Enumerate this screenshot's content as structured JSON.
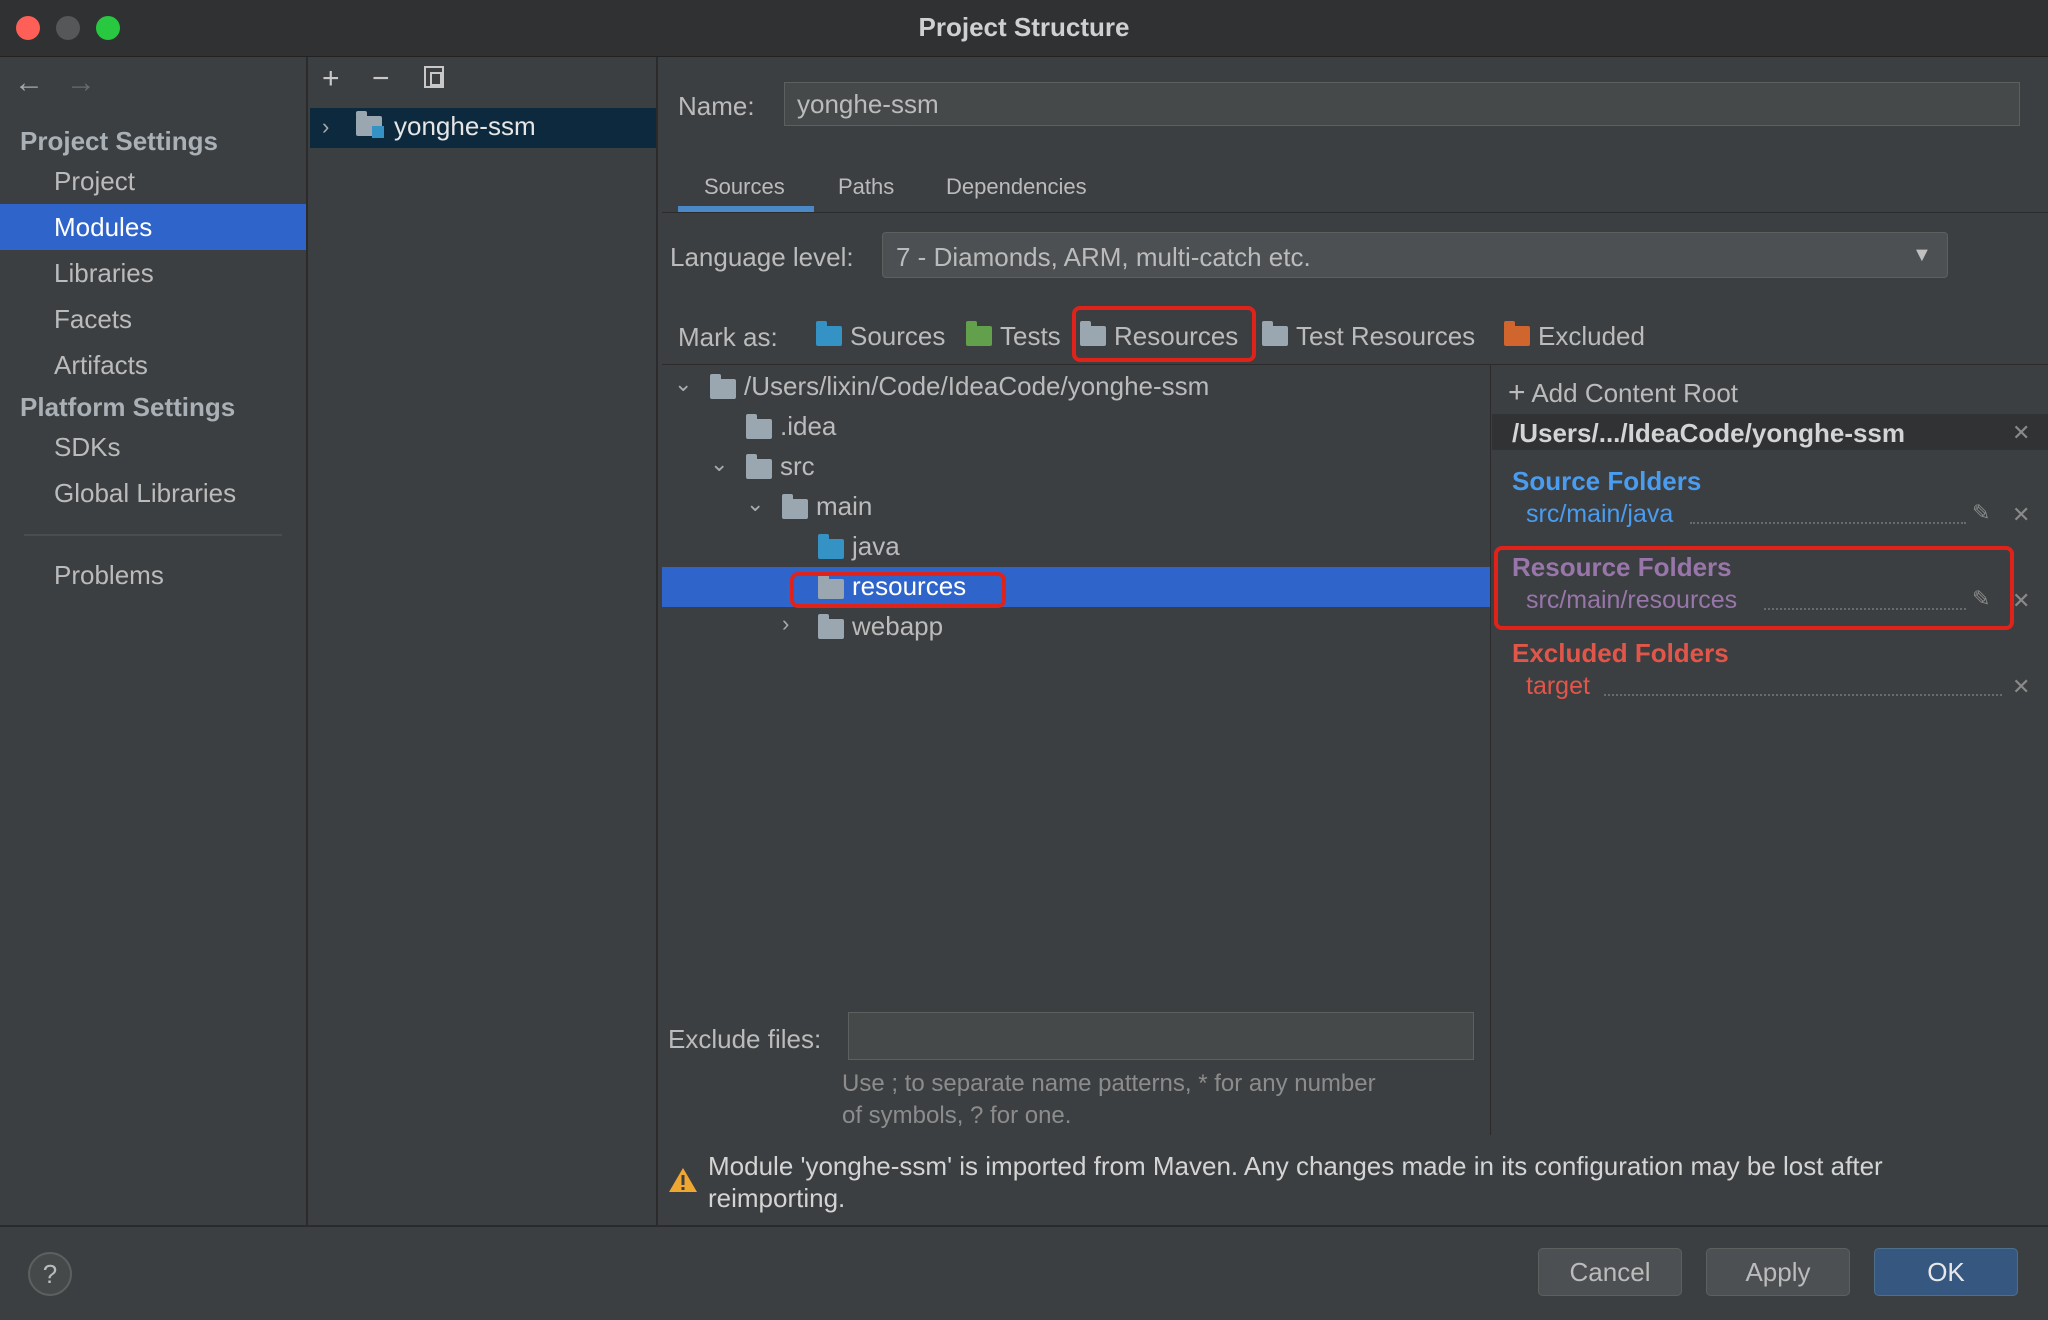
{
  "window": {
    "title": "Project Structure"
  },
  "sidebar": {
    "project_settings_heading": "Project Settings",
    "project_items": [
      "Project",
      "Modules",
      "Libraries",
      "Facets",
      "Artifacts"
    ],
    "selected": "Modules",
    "platform_settings_heading": "Platform Settings",
    "platform_items": [
      "SDKs",
      "Global Libraries"
    ],
    "problems": "Problems"
  },
  "modules": {
    "toolbar_icons": [
      "add-icon",
      "remove-icon",
      "copy-icon"
    ],
    "items": [
      "yonghe-ssm"
    ]
  },
  "name_field": {
    "label": "Name:",
    "value": "yonghe-ssm"
  },
  "tabs": [
    {
      "label": "Sources",
      "active": true
    },
    {
      "label": "Paths",
      "active": false
    },
    {
      "label": "Dependencies",
      "active": false
    }
  ],
  "language_level": {
    "label": "Language level:",
    "value": "7 - Diamonds, ARM, multi-catch etc."
  },
  "mark_as": {
    "label": "Mark as:",
    "buttons": [
      "Sources",
      "Tests",
      "Resources",
      "Test Resources",
      "Excluded"
    ],
    "highlighted": "Resources"
  },
  "tree": [
    {
      "label": "/Users/lixin/Code/IdeaCode/yonghe-ssm",
      "expanded": true
    },
    {
      "label": ".idea"
    },
    {
      "label": "src",
      "expanded": true
    },
    {
      "label": "main",
      "expanded": true
    },
    {
      "label": "java"
    },
    {
      "label": "resources",
      "selected": true
    },
    {
      "label": "webapp",
      "expanded": false
    }
  ],
  "content_roots": {
    "add_label": "Add Content Root",
    "root_path": "/Users/.../IdeaCode/yonghe-ssm",
    "source_heading": "Source Folders",
    "source_path": "src/main/java",
    "resource_heading": "Resource Folders",
    "resource_path": "src/main/resources",
    "excluded_heading": "Excluded Folders",
    "excluded_path": "target"
  },
  "exclude_files": {
    "label": "Exclude files:",
    "value": "",
    "hint_line1": "Use ; to separate name patterns, * for any number",
    "hint_line2": "of symbols, ? for one."
  },
  "warning": "Module 'yonghe-ssm' is imported from Maven. Any changes made in its configuration may be lost after reimporting.",
  "buttons": {
    "help": "?",
    "cancel": "Cancel",
    "apply": "Apply",
    "ok": "OK"
  },
  "colors": {
    "accent_selection": "#2f65ca",
    "source_folder_blue": "#3592c4",
    "test_folder_green": "#62a04b",
    "resource_purple": "#9876aa",
    "excluded_red": "#e2564a",
    "highlight_red": "#e0231a"
  }
}
